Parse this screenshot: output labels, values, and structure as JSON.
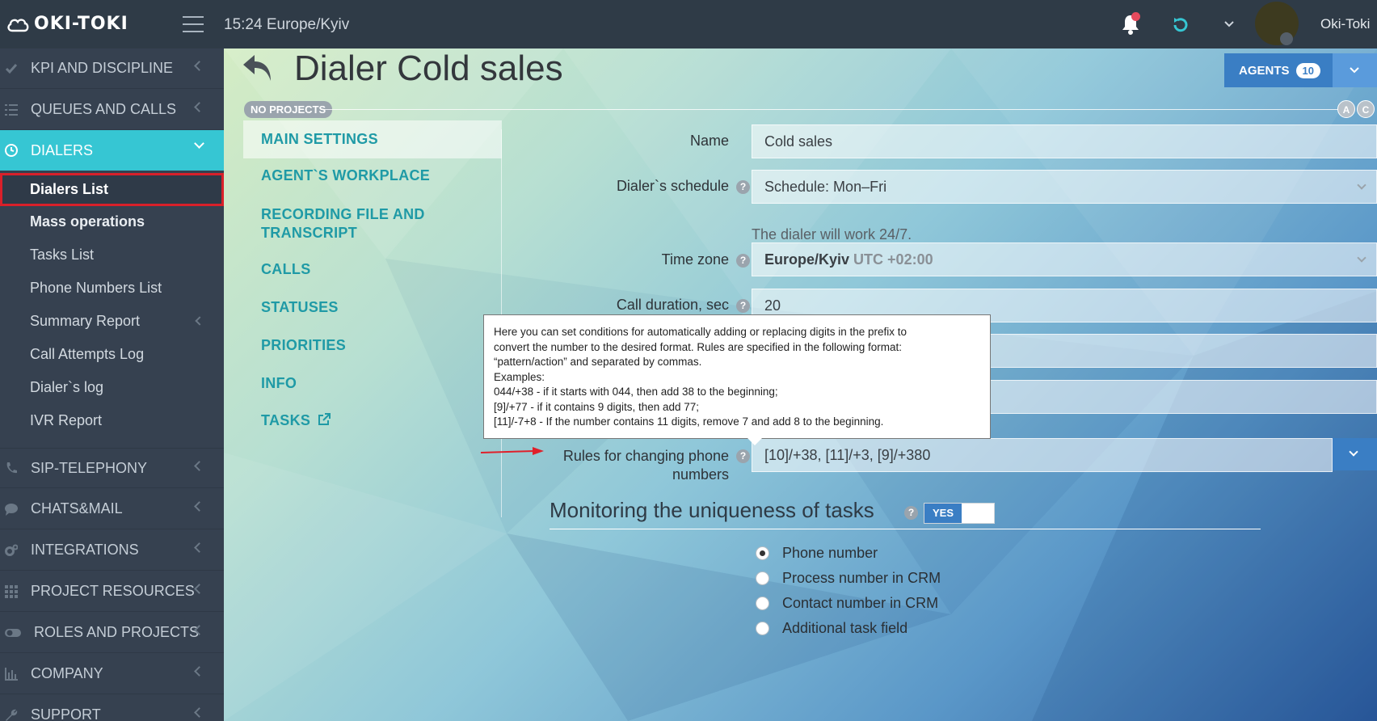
{
  "topbar": {
    "logo": "OKI-TOKI",
    "clock": "15:24  Europe/Kyiv",
    "user": "Oki-Toki"
  },
  "sidebar": {
    "items": [
      {
        "label": "KPI AND DISCIPLINE",
        "icon": "check-icon"
      },
      {
        "label": "QUEUES AND CALLS",
        "icon": "list-icon"
      },
      {
        "label": "DIALERS",
        "icon": "clock-icon"
      },
      {
        "label": "SIP-TELEPHONY",
        "icon": "phone-icon"
      },
      {
        "label": "CHATS&MAIL",
        "icon": "chat-icon"
      },
      {
        "label": "INTEGRATIONS",
        "icon": "gears-icon"
      },
      {
        "label": "PROJECT RESOURCES",
        "icon": "grid-icon"
      },
      {
        "label": "ROLES AND PROJECTS",
        "icon": "toggle-icon"
      },
      {
        "label": "COMPANY",
        "icon": "bar-chart-icon"
      },
      {
        "label": "SUPPORT",
        "icon": "wrench-icon"
      }
    ],
    "dialer_sub": [
      "Dialers List",
      "Mass operations",
      "Tasks List",
      "Phone Numbers List",
      "Summary Report",
      "Call Attempts Log",
      "Dialer`s log",
      "IVR Report"
    ]
  },
  "page": {
    "title": "Dialer Cold sales",
    "projects_badge": "NO PROJECTS",
    "circle_a": "A",
    "circle_c": "C",
    "agents_label": "AGENTS",
    "agents_count": "10"
  },
  "tabs": [
    "MAIN SETTINGS",
    "AGENT`S WORKPLACE",
    "RECORDING FILE AND TRANSCRIPT",
    "CALLS",
    "STATUSES",
    "PRIORITIES",
    "INFO",
    "TASKS"
  ],
  "form": {
    "name_label": "Name",
    "name_value": "Cold sales",
    "schedule_label": "Dialer`s schedule",
    "schedule_value": "Schedule: Mon–Fri",
    "schedule_hint": "The dialer will work 24/7.",
    "tz_label": "Time zone",
    "tz_value": "Europe/Kyiv",
    "tz_utc": "UTC +02:00",
    "duration_label": "Call duration, sec",
    "duration_value": "20",
    "rules_label": "Rules for changing phone numbers",
    "rules_value": "[10]/+38, [11]/+3, [9]/+380"
  },
  "tooltip": {
    "lines": [
      "Here you can set conditions for automatically adding or replacing digits in the prefix to",
      "convert the number to the desired format. Rules are specified in the following format:",
      "“pattern/action” and separated by commas.",
      "Examples:",
      "044/+38 - if it starts with 044, then add 38 to the beginning;",
      "[9]/+77 - if it contains 9 digits, then add 77;",
      "[11]/-7+8 - If the number contains 11 digits, remove 7 and add 8 to the beginning."
    ]
  },
  "monitoring": {
    "title": "Monitoring the uniqueness of tasks",
    "toggle": "YES",
    "options": [
      "Phone number",
      "Process number in CRM",
      "Contact number in CRM",
      "Additional task field"
    ],
    "selected": 0
  },
  "colors": {
    "accent": "#36c6d3",
    "primary": "#3a7ec4",
    "sidebar": "#364150",
    "topbar": "#2f3b47",
    "highlight": "#d9202a"
  }
}
